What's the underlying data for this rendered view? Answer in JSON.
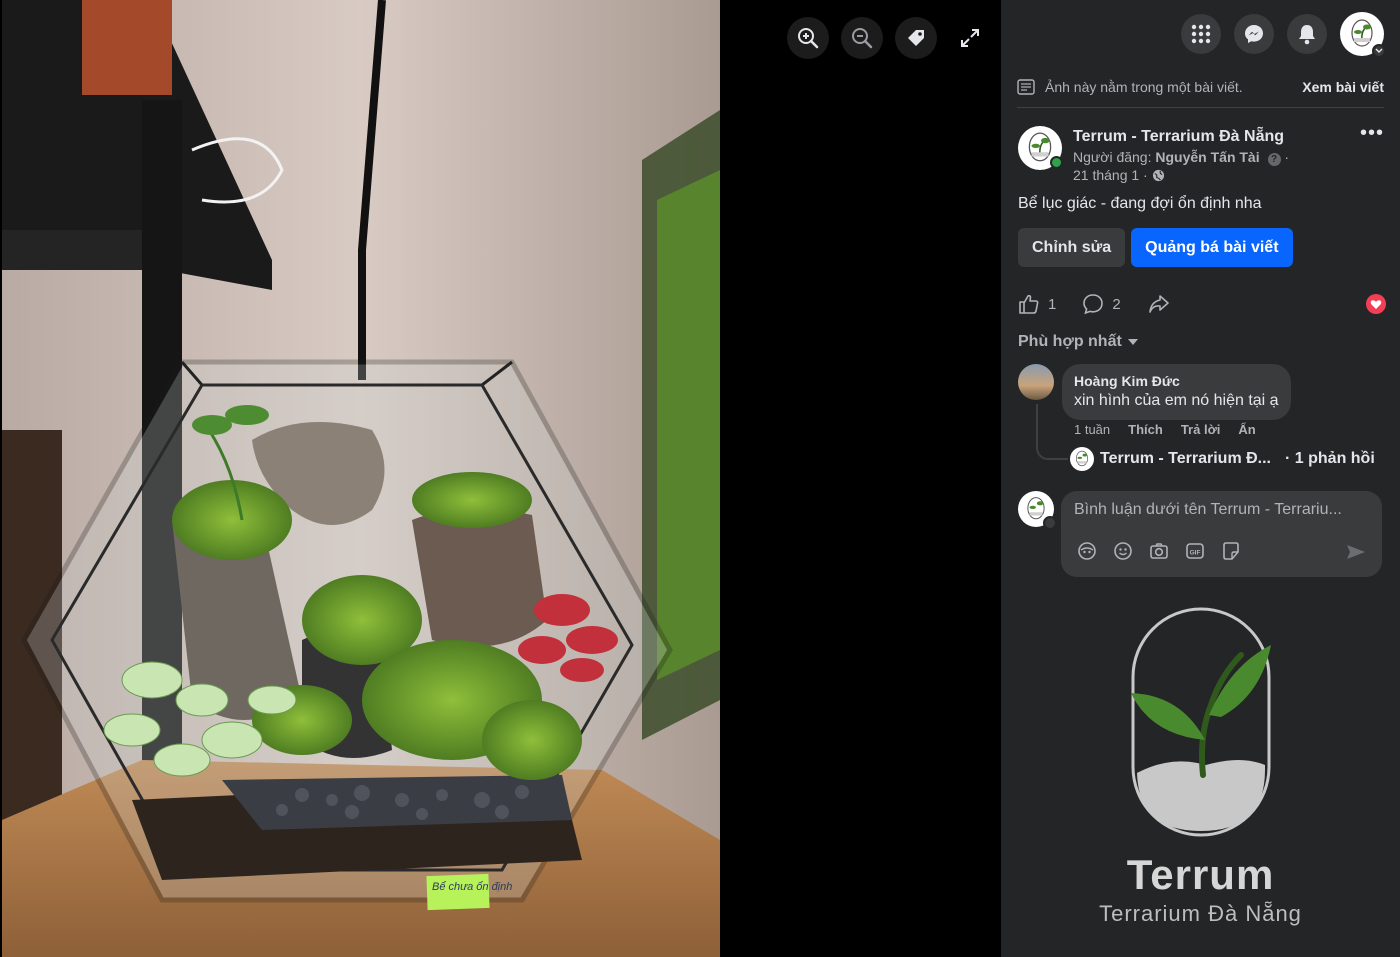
{
  "viewer": {
    "tools": [
      {
        "name": "zoom-in-icon"
      },
      {
        "name": "zoom-out-icon"
      },
      {
        "name": "tag-icon"
      },
      {
        "name": "fullscreen-icon"
      }
    ],
    "photo_sticky_note": "Bể chưa ổn định"
  },
  "topbar": {
    "icons": [
      "apps-grid-icon",
      "messenger-icon",
      "bell-icon",
      "profile-avatar"
    ]
  },
  "notice": {
    "text": "Ảnh này nằm trong một bài viết.",
    "link": "Xem bài viết"
  },
  "post": {
    "page_name": "Terrum - Terrarium Đà Nẵng",
    "poster_prefix": "Người đăng: ",
    "poster_name": "Nguyễn Tấn Tài",
    "date": "21 tháng 1 ·",
    "caption": "Bể lục giác - đang đợi ổn định nha",
    "edit_label": "Chỉnh sửa",
    "boost_label": "Quảng bá bài viết",
    "like_count": "1",
    "comment_count": "2"
  },
  "comments": {
    "sort_label": "Phù hợp nhất",
    "items": [
      {
        "author": "Hoàng Kim Đức",
        "text": "xin hình của em nó hiện tại ạ",
        "time": "1 tuần",
        "like": "Thích",
        "reply": "Trả lời",
        "hide": "Ẩn"
      }
    ],
    "reply_summary": {
      "name": "Terrum - Terrarium Đ...",
      "count": "· 1 phản hồi"
    },
    "composer_placeholder": "Bình luận dưới tên Terrum - Terrariu..."
  },
  "brand": {
    "logo_title": "Terrum",
    "logo_subtitle": "Terrarium Đà Nẵng",
    "colors": {
      "leaf": "#4a8a2e",
      "soil": "#c8c8c8",
      "accent_blue": "#0866ff",
      "panel_bg": "#242526"
    }
  }
}
